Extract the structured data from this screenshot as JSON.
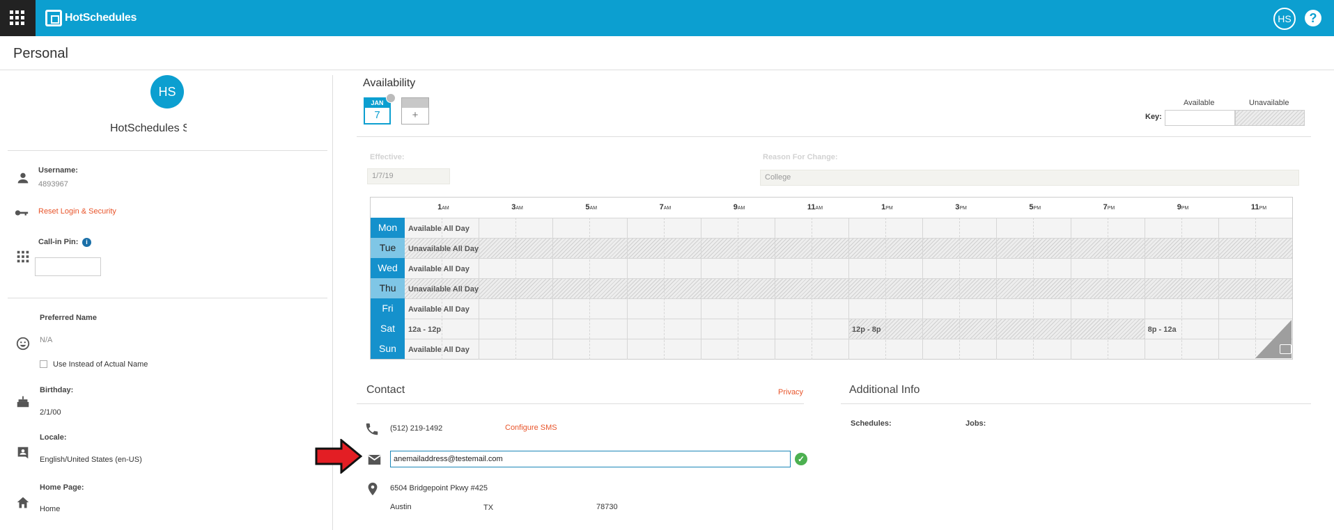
{
  "app": {
    "name": "HotSchedules",
    "user_initials": "HS",
    "help_label": "?"
  },
  "page": {
    "title": "Personal"
  },
  "profile": {
    "initials": "HS",
    "name": "HotSchedules S",
    "username_label": "Username:",
    "username": "4893967",
    "reset_link": "Reset Login & Security",
    "pin_label": "Call-in Pin:",
    "pin_value": "",
    "info_icon": "i",
    "preferred_name_label": "Preferred Name",
    "preferred_name": "N/A",
    "use_instead_label": "Use Instead of Actual Name",
    "birthday_label": "Birthday:",
    "birthday": "2/1/00",
    "locale_label": "Locale:",
    "locale": "English/United States (en-US)",
    "home_page_label": "Home Page:",
    "home_page": "Home"
  },
  "availability": {
    "title": "Availability",
    "date_tile": {
      "month": "JAN",
      "day": "7"
    },
    "add_label": "+",
    "key_label": "Key:",
    "key_available": "Available",
    "key_unavailable": "Unavailable",
    "effective_label": "Effective:",
    "effective_value": "1/7/19",
    "reason_label": "Reason For Change:",
    "reason_value": "College",
    "hours": [
      {
        "n": "1",
        "s": "AM"
      },
      {
        "n": "3",
        "s": "AM"
      },
      {
        "n": "5",
        "s": "AM"
      },
      {
        "n": "7",
        "s": "AM"
      },
      {
        "n": "9",
        "s": "AM"
      },
      {
        "n": "11",
        "s": "AM"
      },
      {
        "n": "1",
        "s": "PM"
      },
      {
        "n": "3",
        "s": "PM"
      },
      {
        "n": "5",
        "s": "PM"
      },
      {
        "n": "7",
        "s": "PM"
      },
      {
        "n": "9",
        "s": "PM"
      },
      {
        "n": "11",
        "s": "PM"
      }
    ],
    "days": [
      {
        "day": "Mon",
        "status": "available",
        "text": "Available All Day"
      },
      {
        "day": "Tue",
        "status": "unavailable",
        "text": "Unavailable All Day"
      },
      {
        "day": "Wed",
        "status": "available",
        "text": "Available All Day"
      },
      {
        "day": "Thu",
        "status": "unavailable",
        "text": "Unavailable All Day"
      },
      {
        "day": "Fri",
        "status": "available",
        "text": "Available All Day"
      },
      {
        "day": "Sat",
        "status": "mixed",
        "text": "",
        "segments": [
          {
            "label": "12a - 12p",
            "from": 0,
            "to": 12,
            "status": "available"
          },
          {
            "label": "12p - 8p",
            "from": 12,
            "to": 20,
            "status": "unavailable"
          },
          {
            "label": "8p - 12a",
            "from": 20,
            "to": 24,
            "status": "available"
          }
        ]
      },
      {
        "day": "Sun",
        "status": "available",
        "text": "Available All Day"
      }
    ]
  },
  "contact": {
    "title": "Contact",
    "privacy_link": "Privacy",
    "phone": "(512) 219-1492",
    "configure_sms": "Configure SMS",
    "email": "anemailaddress@testemail.com",
    "address_line": "6504 Bridgepoint Pkwy #425",
    "city": "Austin",
    "state": "TX",
    "zip": "78730"
  },
  "additional": {
    "title": "Additional Info",
    "schedules_label": "Schedules:",
    "jobs_label": "Jobs:"
  },
  "colors": {
    "brand": "#0c9fd0",
    "link": "#e8542a",
    "arrow": "#e31e24",
    "ok": "#4cb050"
  }
}
